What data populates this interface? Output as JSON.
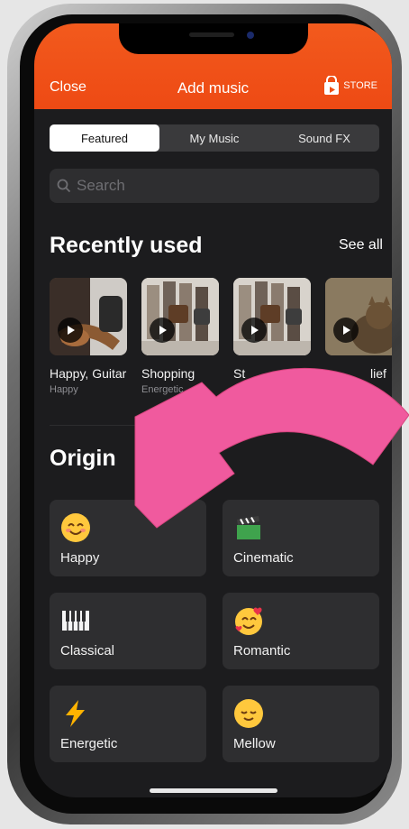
{
  "header": {
    "close_label": "Close",
    "title": "Add music",
    "store_label": "STORE"
  },
  "tabs": [
    "Featured",
    "My Music",
    "Sound FX"
  ],
  "search": {
    "placeholder": "Search"
  },
  "recent": {
    "title": "Recently used",
    "see_all": "See all",
    "items": [
      {
        "name": "Happy, Guitar",
        "sub": "Happy"
      },
      {
        "name": "Shopping",
        "sub": "Energetic"
      },
      {
        "name": "St",
        "sub": ""
      },
      {
        "name": "lief",
        "sub": ""
      }
    ]
  },
  "originals": {
    "title": "Origin",
    "moods": [
      {
        "label": "Happy",
        "icon": "smiling-face-icon"
      },
      {
        "label": "Cinematic",
        "icon": "clapper-board-icon"
      },
      {
        "label": "Classical",
        "icon": "piano-keys-icon"
      },
      {
        "label": "Romantic",
        "icon": "smiling-face-with-hearts-icon"
      },
      {
        "label": "Energetic",
        "icon": "lightning-bolt-icon"
      },
      {
        "label": "Mellow",
        "icon": "relieved-face-icon"
      }
    ]
  },
  "colors": {
    "header": "#ef4f17",
    "background": "#1c1c1e",
    "card": "#2e2e30",
    "arrow": "#f05a9e"
  }
}
